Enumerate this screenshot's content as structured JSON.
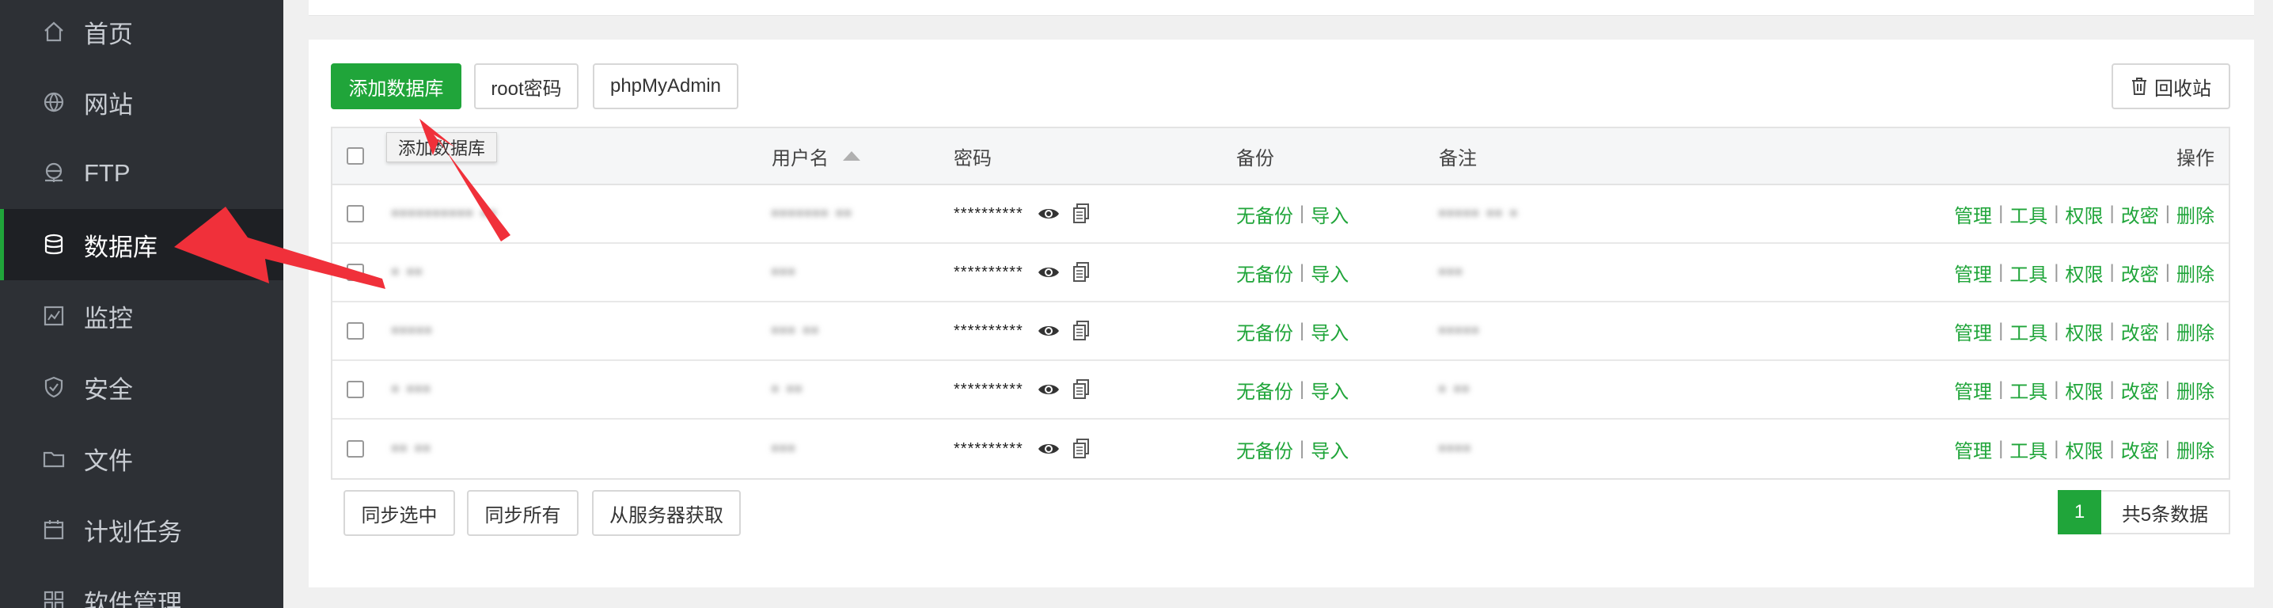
{
  "sidebar": {
    "items": [
      {
        "label": "首页",
        "icon": "home-icon"
      },
      {
        "label": "网站",
        "icon": "globe-icon"
      },
      {
        "label": "FTP",
        "icon": "ftp-server-icon"
      },
      {
        "label": "数据库",
        "icon": "database-icon",
        "active": true
      },
      {
        "label": "监控",
        "icon": "monitor-icon"
      },
      {
        "label": "安全",
        "icon": "shield-icon"
      },
      {
        "label": "文件",
        "icon": "folder-icon"
      },
      {
        "label": "计划任务",
        "icon": "calendar-icon"
      },
      {
        "label": "软件管理",
        "icon": "apps-icon"
      }
    ]
  },
  "toolbar": {
    "add_db_label": "添加数据库",
    "root_pw_label": "root密码",
    "phpmyadmin_label": "phpMyAdmin",
    "recycle_label": "回收站",
    "tooltip": "添加数据库"
  },
  "table": {
    "headers": {
      "username": "用户名",
      "password": "密码",
      "backup": "备份",
      "remark": "备注",
      "actions": "操作"
    },
    "rows": [
      {
        "name": "•••••••••• ••",
        "user": "••••••• ••",
        "password": "**********",
        "backup": "无备份",
        "import": "导入",
        "remark": "••••• •• •"
      },
      {
        "name": "• ••",
        "user": "•••",
        "password": "**********",
        "backup": "无备份",
        "import": "导入",
        "remark": "•••"
      },
      {
        "name": "•••••",
        "user": "••• ••",
        "password": "**********",
        "backup": "无备份",
        "import": "导入",
        "remark": "•••••"
      },
      {
        "name": "• •••",
        "user": "• ••",
        "password": "**********",
        "backup": "无备份",
        "import": "导入",
        "remark": "• ••"
      },
      {
        "name": "•• ••",
        "user": "•••",
        "password": "**********",
        "backup": "无备份",
        "import": "导入",
        "remark": "••••"
      }
    ],
    "row_actions": {
      "manage": "管理",
      "tools": "工具",
      "perm": "权限",
      "change_pw": "改密",
      "delete": "删除"
    }
  },
  "footer": {
    "sync_selected": "同步选中",
    "sync_all": "同步所有",
    "fetch_server": "从服务器获取",
    "current_page": "1",
    "total": "共5条数据"
  },
  "colors": {
    "accent": "#20a53a",
    "sidebar_bg": "#2d3035",
    "arrow": "#f0303a"
  }
}
